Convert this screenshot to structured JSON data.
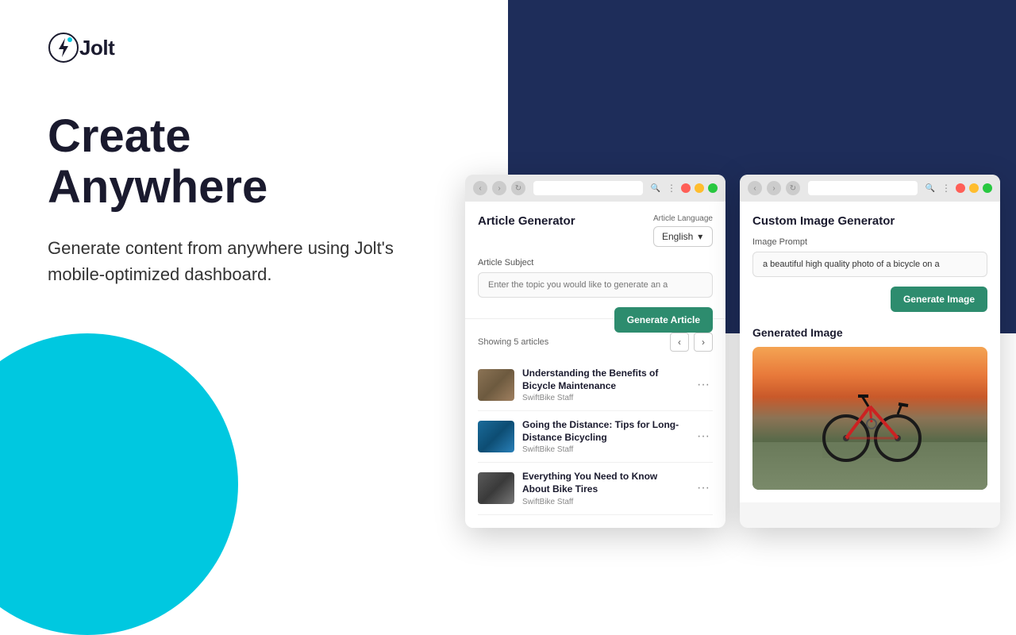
{
  "logo": {
    "text": "Jolt",
    "icon_name": "jolt-icon"
  },
  "hero": {
    "headline": "Create Anywhere",
    "subheadline": "Generate content from anywhere using Jolt's mobile-optimized dashboard."
  },
  "article_generator_panel": {
    "title": "Article Generator",
    "language_label": "Article Language",
    "language_value": "English",
    "subject_label": "Article Subject",
    "subject_placeholder": "Enter the topic you would like to generate an a",
    "generate_btn_label": "Generate Article",
    "articles_count": "Showing 5 articles",
    "articles": [
      {
        "title": "Understanding the Benefits of Bicycle Maintenance",
        "author": "SwiftBike Staff",
        "thumb_type": "maintenance"
      },
      {
        "title": "Going the Distance: Tips for Long-Distance Bicycling",
        "author": "SwiftBike Staff",
        "thumb_type": "cycling"
      },
      {
        "title": "Everything You Need to Know About Bike Tires",
        "author": "SwiftBike Staff",
        "thumb_type": "tires"
      }
    ]
  },
  "image_generator_panel": {
    "title": "Custom Image Generator",
    "prompt_label": "Image Prompt",
    "prompt_value": "a beautiful high quality photo of a bicycle on a",
    "generate_btn_label": "Generate Image",
    "generated_image_label": "Generated Image"
  },
  "colors": {
    "dark_bg": "#1e2d5a",
    "cyan_bg": "#00c8e0",
    "generate_btn": "#2d8c6e",
    "text_dark": "#1a1a2e"
  },
  "browser_bar": {
    "nav": [
      "‹",
      "›",
      "↻"
    ],
    "traffic_lights": [
      "red",
      "yellow",
      "green"
    ]
  }
}
